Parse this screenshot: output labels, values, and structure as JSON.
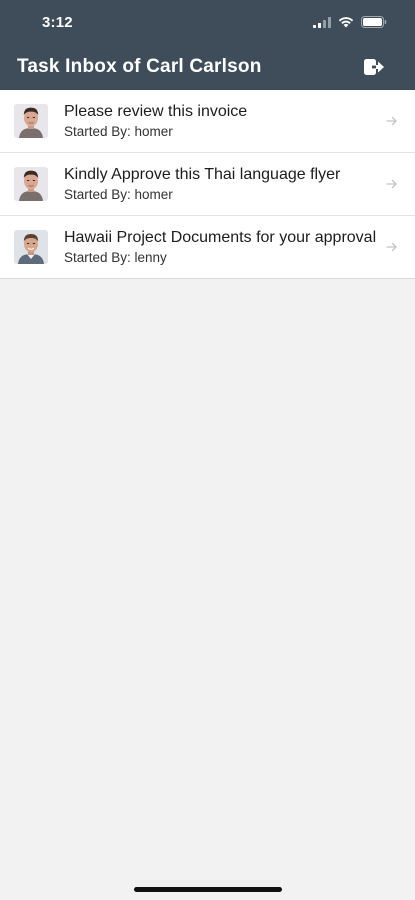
{
  "status_bar": {
    "time": "3:12",
    "icons": [
      "signal-icon",
      "wifi-icon",
      "battery-icon"
    ]
  },
  "header": {
    "title": "Task Inbox of Carl Carlson",
    "action_icon": "logout-icon",
    "background_color": "#3f4d5b",
    "text_color": "#ffffff"
  },
  "tasks": [
    {
      "title": "Please review this invoice",
      "started_by_label": "Started By: homer",
      "avatar_icon": "user-avatar"
    },
    {
      "title": "Kindly Approve this Thai language flyer",
      "started_by_label": "Started By: homer",
      "avatar_icon": "user-avatar"
    },
    {
      "title": "Hawaii Project Documents for your approval",
      "started_by_label": "Started By: lenny",
      "avatar_icon": "user-avatar"
    }
  ],
  "colors": {
    "page_background": "#f2f2f2",
    "list_background": "#ffffff",
    "chevron": "#c4c4c4"
  }
}
